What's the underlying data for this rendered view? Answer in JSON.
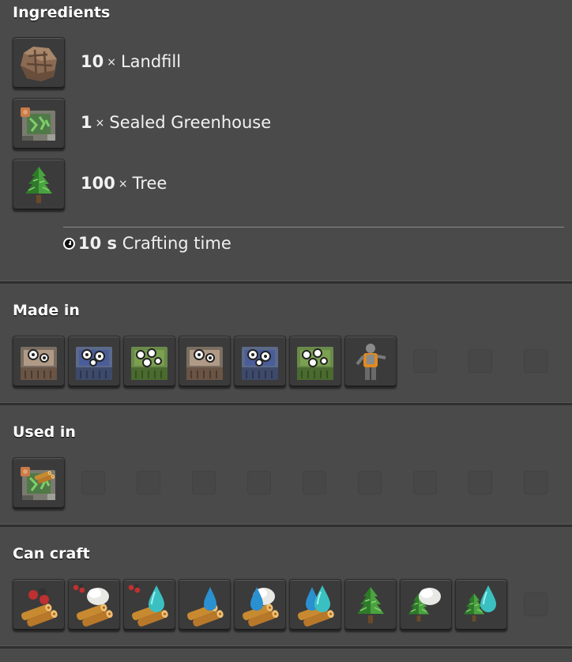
{
  "ingredients": {
    "title": "Ingredients",
    "items": [
      {
        "amount": "10",
        "times": "×",
        "name": "Landfill",
        "icon": "landfill-icon"
      },
      {
        "amount": "1",
        "times": "×",
        "name": "Sealed Greenhouse",
        "icon": "sealed-greenhouse-icon"
      },
      {
        "amount": "100",
        "times": "×",
        "name": "Tree",
        "icon": "tree-icon"
      }
    ],
    "crafting_time": {
      "value": "10 s",
      "label": "Crafting time",
      "icon": "clock-icon"
    }
  },
  "made_in": {
    "title": "Made in",
    "items": [
      "assembling-machine-1-icon",
      "assembling-machine-2-icon",
      "assembling-machine-3-icon",
      "assembling-machine-1-icon",
      "assembling-machine-2-icon",
      "assembling-machine-3-icon",
      "character-icon"
    ]
  },
  "used_in": {
    "title": "Used in",
    "items": [
      "sealed-greenhouse-recipe-icon"
    ]
  },
  "can_craft": {
    "title": "Can craft",
    "items": [
      "wood-from-seeds-icon",
      "wood-from-soil-icon",
      "wood-from-seeds-water-icon",
      "wood-from-water-icon",
      "wood-from-soil-water-icon",
      "wood-from-water-2-icon",
      "tree-icon",
      "tree-from-soil-icon",
      "tree-from-water-icon"
    ]
  },
  "colors": {
    "background": "#4a4a4a",
    "slot": "#3b3b3b",
    "text": "#f0f0f0"
  }
}
